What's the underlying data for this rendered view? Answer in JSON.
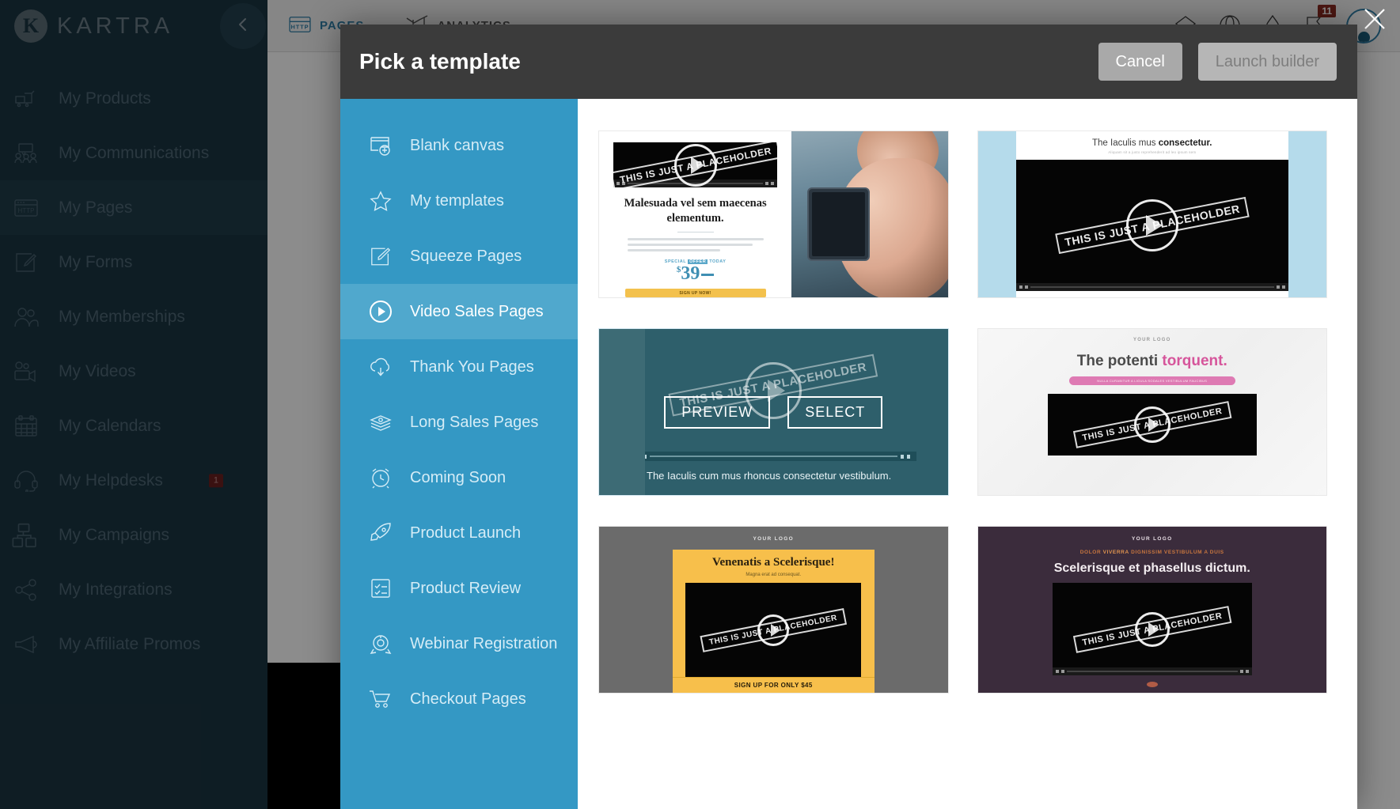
{
  "app": {
    "brand": "KARTRA",
    "brand_mark": "K",
    "collapse_icon": "chevron-left-icon",
    "close_icon": "close-icon",
    "nav_items": [
      {
        "label": "My Products",
        "icon": "cart-icon"
      },
      {
        "label": "My Communications",
        "icon": "chat-people-icon"
      },
      {
        "label": "My Pages",
        "icon": "http-browser-icon",
        "active": true
      },
      {
        "label": "My Forms",
        "icon": "pencil-square-icon"
      },
      {
        "label": "My Memberships",
        "icon": "people-icon"
      },
      {
        "label": "My Videos",
        "icon": "video-camera-icon"
      },
      {
        "label": "My Calendars",
        "icon": "calendar-icon"
      },
      {
        "label": "My Helpdesks",
        "icon": "headset-icon",
        "badge": "1"
      },
      {
        "label": "My Campaigns",
        "icon": "sitemap-icon"
      },
      {
        "label": "My Integrations",
        "icon": "share-nodes-icon"
      },
      {
        "label": "My Affiliate Promos",
        "icon": "megaphone-icon"
      }
    ],
    "top_tabs": [
      {
        "label": "PAGES",
        "icon": "http-browser-icon"
      },
      {
        "label": "ANALYTICS",
        "icon": "bar-chart-icon"
      }
    ],
    "top_right_icons": [
      {
        "name": "diamond-icon"
      },
      {
        "name": "umbrella-icon"
      },
      {
        "name": "drop-icon"
      },
      {
        "name": "flag-icon",
        "badge": "11"
      }
    ]
  },
  "modal": {
    "title": "Pick a template",
    "cancel_label": "Cancel",
    "launch_label": "Launch builder",
    "categories": [
      {
        "label": "Blank canvas",
        "icon": "window-plus-icon"
      },
      {
        "label": "My templates",
        "icon": "star-icon"
      },
      {
        "label": "Squeeze Pages",
        "icon": "pencil-square-icon"
      },
      {
        "label": "Video Sales Pages",
        "icon": "play-circle-icon",
        "active": true
      },
      {
        "label": "Thank You Pages",
        "icon": "cloud-download-icon"
      },
      {
        "label": "Long Sales Pages",
        "icon": "money-stack-icon"
      },
      {
        "label": "Coming Soon",
        "icon": "alarm-clock-icon"
      },
      {
        "label": "Product Launch",
        "icon": "rocket-icon"
      },
      {
        "label": "Product Review",
        "icon": "checklist-icon"
      },
      {
        "label": "Webinar Registration",
        "icon": "stopwatch-icon"
      },
      {
        "label": "Checkout Pages",
        "icon": "shopping-cart-icon"
      }
    ],
    "hover_actions": {
      "preview_label": "PREVIEW",
      "select_label": "SELECT"
    },
    "video_placeholder_stamp": "THIS IS JUST A PLACEHOLDER",
    "templates": [
      {
        "id": "tpl-1",
        "heading": "Malesuada vel sem maecenas elementum.",
        "offer_pre": "SPECIAL",
        "offer_mid": "OFFER",
        "offer_post": "TODAY",
        "price": "39",
        "price_currency": "$",
        "cta": "SIGN UP NOW!"
      },
      {
        "id": "tpl-2",
        "heading_light": "The Iaculis mus ",
        "heading_bold": "consectetur.",
        "subheading": "Aliquam sit a justo reprehenderit ad leo ipsum sem"
      },
      {
        "id": "tpl-3",
        "caption": "The Iaculis cum mus rhoncus consectetur vestibulum.",
        "hovered": true
      },
      {
        "id": "tpl-4",
        "logo": "YOUR LOGO",
        "heading_light": "The potenti ",
        "heading_bold": "torquent.",
        "pill_text": "NULLA CURABITUR A LIGULA SODALES VESTIBULUM FAUCIBUS"
      },
      {
        "id": "tpl-5",
        "logo": "YOUR LOGO",
        "heading": "Venenatis a Scelerisque!",
        "subheading": "Magna erat ad consequat.",
        "cta": "SIGN UP FOR ONLY $45"
      },
      {
        "id": "tpl-6",
        "logo": "YOUR LOGO",
        "kicker_a": "DOLOR ",
        "kicker_b": "VIVERRA",
        "kicker_c": " DIGNISSIM VESTIBULUM A DUIS",
        "heading": "Scelerisque et phasellus dictum."
      }
    ]
  },
  "colors": {
    "sidebar_bg": "#1b3542",
    "modal_header": "#3b3b3b",
    "category_bg": "#3498c4",
    "category_active": "#50a8cd",
    "accent_blue": "#2f7fa8",
    "badge_red": "#8b2a21",
    "yellow": "#f7bf4b",
    "pink": "#d6559b"
  }
}
